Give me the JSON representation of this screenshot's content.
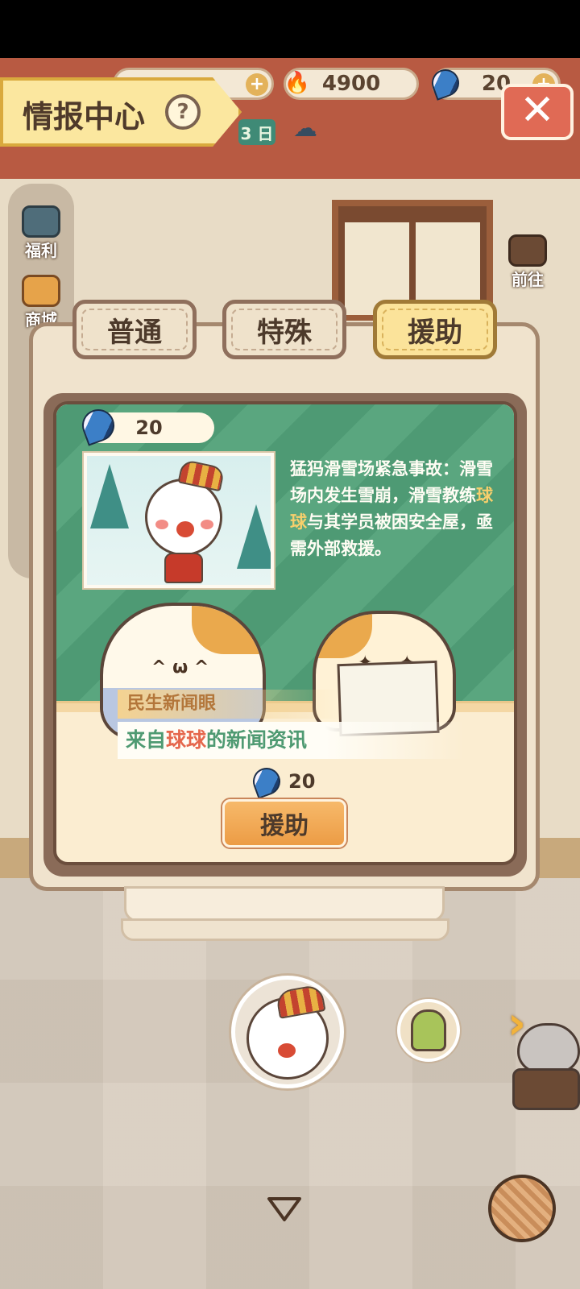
{
  "top_bar": {
    "coins": "",
    "flame_amount": "4900",
    "banana_amount": "20",
    "day_badge": "3 日"
  },
  "title": {
    "text": "情报中心",
    "help_glyph": "?"
  },
  "side_buttons": {
    "welfare": "福利",
    "shop": "商城",
    "goto": "前往"
  },
  "tabs": [
    {
      "label": "普通",
      "active": false
    },
    {
      "label": "特殊",
      "active": false
    },
    {
      "label": "援助",
      "active": true
    }
  ],
  "mission": {
    "cost": "20",
    "story_prefix": "猛犸滑雪场紧急事故：滑雪场内发生雪崩，滑雪教练",
    "story_highlight": "球球",
    "story_suffix": "与其学员被困安全屋，亟需外部救援。",
    "news_label": "民生新闻眼",
    "news_prefix": "来自",
    "news_highlight": "球球",
    "news_suffix": "的新闻资讯",
    "reward_amount": "20",
    "action_label": "援助"
  },
  "colors": {
    "accent_green": "#4e9a74",
    "accent_orange": "#ec9c45",
    "highlight_yellow": "#f7cf6c",
    "highlight_red": "#e5674c"
  },
  "icons": {
    "close": "close-icon",
    "resource_banana": "banana-icon",
    "resource_flame": "flame-icon",
    "weather": "rain-cloud-icon",
    "next": "chevron-right-icon",
    "collapse": "triangle-down-icon"
  }
}
